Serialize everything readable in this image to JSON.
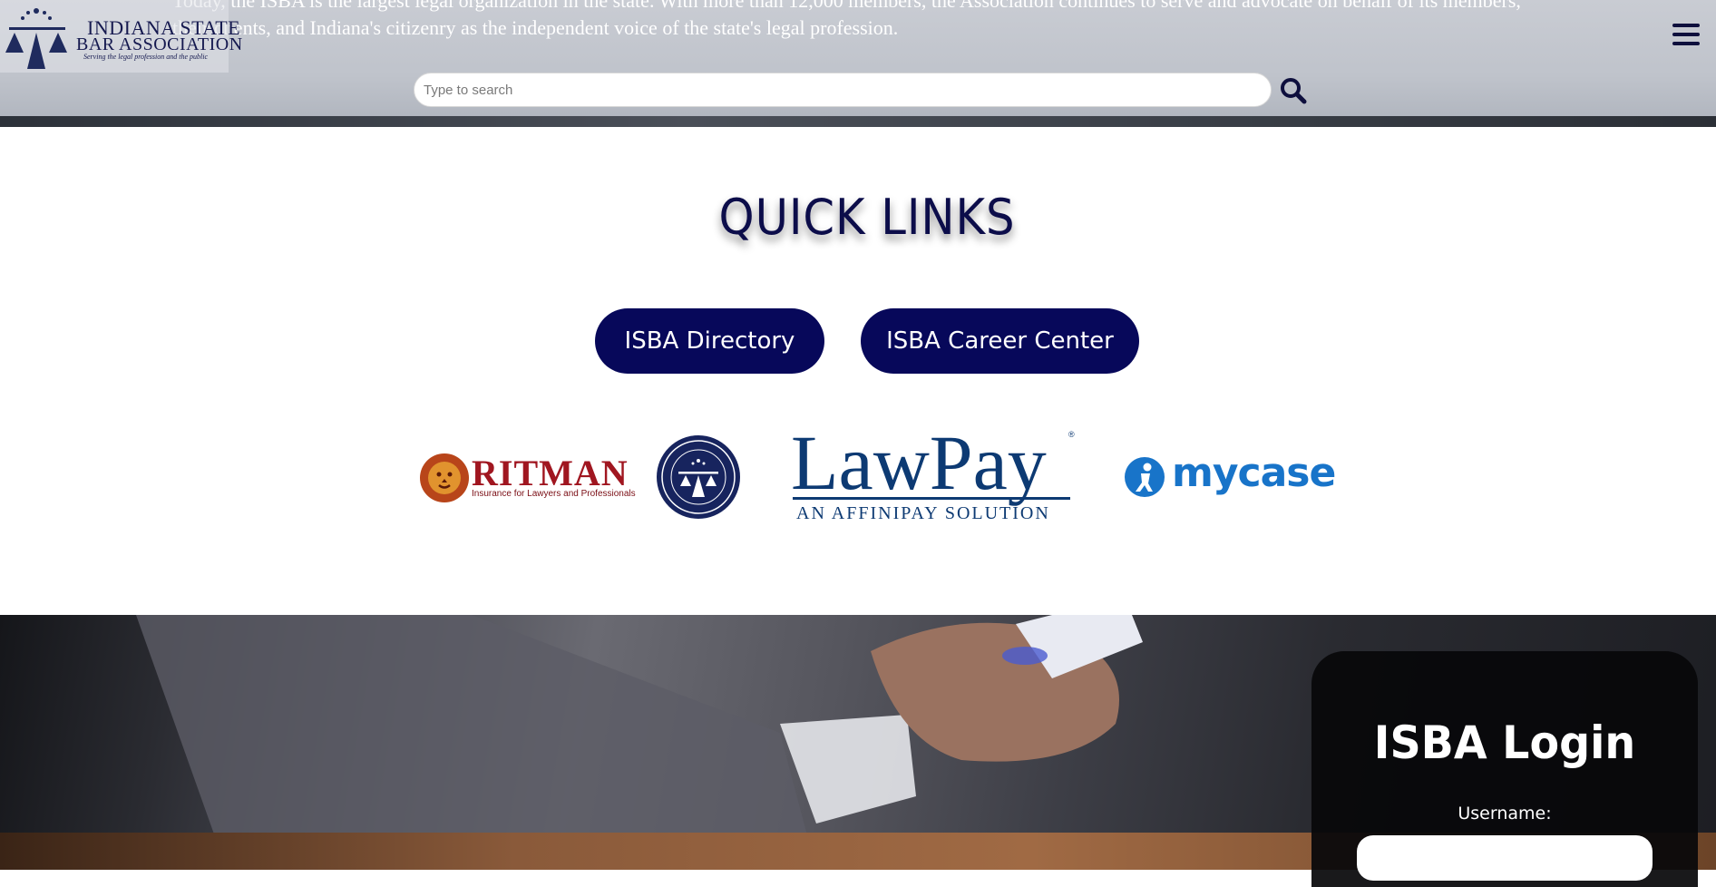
{
  "header": {
    "intro_text": "Today, the ISBA is the largest legal organization in the state. With more than 12,000 members, the Association continues to serve and advocate on behalf of its members, their clients, and Indiana's citizenry as the independent voice of the state's legal profession.",
    "logo": {
      "line1": "Indiana State",
      "line2": "Bar Association",
      "tagline": "Serving the legal profession and the public"
    },
    "menu_icon": "hamburger-menu-icon",
    "search": {
      "placeholder": "Type to search",
      "value": "",
      "icon": "search-icon"
    }
  },
  "quick_links": {
    "title": "QUICK LINKS",
    "buttons": [
      {
        "label": "ISBA Directory"
      },
      {
        "label": "ISBA Career Center"
      }
    ],
    "partners": {
      "ritman": {
        "name": "RITMAN",
        "tagline": "Insurance for Lawyers and Professionals"
      },
      "insurance_agency": {
        "seal_text": "Indiana State Bar Association Insurance Agency"
      },
      "lawpay": {
        "name": "LawPay",
        "tagline": "AN AFFINIPAY SOLUTION",
        "reg": "®"
      },
      "mycase": {
        "name": "mycase"
      }
    }
  },
  "login": {
    "title": "ISBA Login",
    "username_label": "Username:",
    "username_value": ""
  },
  "colors": {
    "navy": "#07085a",
    "title_navy": "#0c0d4a",
    "ritman_red": "#a01620",
    "lawpay_blue": "#0d3a73",
    "mycase_blue": "#1874c9"
  }
}
